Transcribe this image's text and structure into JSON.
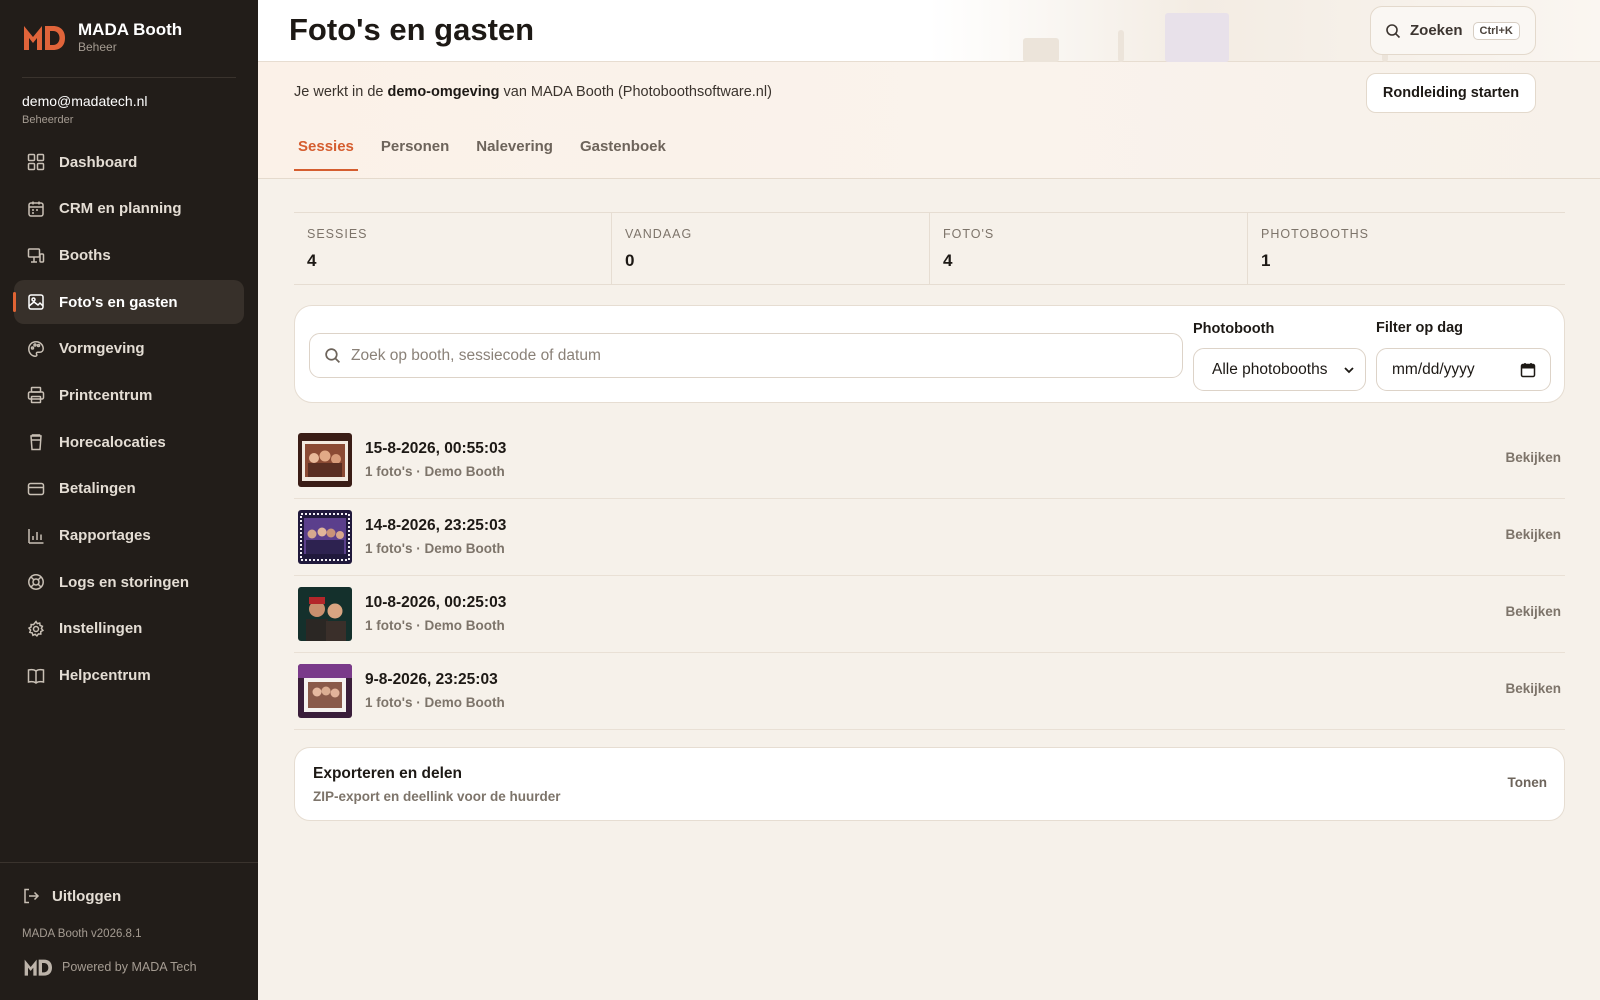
{
  "brand": {
    "name": "MADA Booth",
    "subtitle": "Beheer"
  },
  "user": {
    "email": "demo@madatech.nl",
    "role": "Beheerder"
  },
  "nav": [
    {
      "label": "Dashboard",
      "icon": "dashboard-icon",
      "active": false
    },
    {
      "label": "CRM en planning",
      "icon": "calendar-icon",
      "active": false
    },
    {
      "label": "Booths",
      "icon": "booth-icon",
      "active": false
    },
    {
      "label": "Foto's en gasten",
      "icon": "image-icon",
      "active": true
    },
    {
      "label": "Vormgeving",
      "icon": "palette-icon",
      "active": false
    },
    {
      "label": "Printcentrum",
      "icon": "printer-icon",
      "active": false
    },
    {
      "label": "Horecalocaties",
      "icon": "venue-icon",
      "active": false
    },
    {
      "label": "Betalingen",
      "icon": "credit-card-icon",
      "active": false
    },
    {
      "label": "Rapportages",
      "icon": "bar-chart-icon",
      "active": false
    },
    {
      "label": "Logs en storingen",
      "icon": "lifebuoy-icon",
      "active": false
    },
    {
      "label": "Instellingen",
      "icon": "gear-icon",
      "active": false
    },
    {
      "label": "Helpcentrum",
      "icon": "book-icon",
      "active": false
    }
  ],
  "footer": {
    "logout": "Uitloggen",
    "version": "MADA Booth v2026.8.1",
    "powered": "Powered by MADA Tech"
  },
  "header": {
    "title": "Foto's en gasten",
    "search_label": "Zoeken",
    "search_shortcut": "Ctrl+K"
  },
  "notice": {
    "prefix": "Je werkt in de",
    "bold": "demo-omgeving",
    "suffix": "van MADA Booth (Photoboothsoftware.nl)",
    "tour_button": "Rondleiding starten"
  },
  "tabs": [
    {
      "label": "Sessies",
      "active": true
    },
    {
      "label": "Personen",
      "active": false
    },
    {
      "label": "Nalevering",
      "active": false
    },
    {
      "label": "Gastenboek",
      "active": false
    }
  ],
  "stats": [
    {
      "label": "SESSIES",
      "value": "4"
    },
    {
      "label": "VANDAAG",
      "value": "0"
    },
    {
      "label": "FOTO'S",
      "value": "4"
    },
    {
      "label": "PHOTOBOOTHS",
      "value": "1"
    }
  ],
  "filters": {
    "search_placeholder": "Zoek op booth, sessiecode of datum",
    "photobooth_label": "Photobooth",
    "photobooth_value": "Alle photobooths",
    "date_label": "Filter op dag",
    "date_placeholder": "mm/dd/yyyy"
  },
  "sessions": [
    {
      "date": "15-8-2026, 00:55:03",
      "meta": "1 foto's · Demo Booth",
      "action": "Bekijken"
    },
    {
      "date": "14-8-2026, 23:25:03",
      "meta": "1 foto's · Demo Booth",
      "action": "Bekijken"
    },
    {
      "date": "10-8-2026, 00:25:03",
      "meta": "1 foto's · Demo Booth",
      "action": "Bekijken"
    },
    {
      "date": "9-8-2026, 23:25:03",
      "meta": "1 foto's · Demo Booth",
      "action": "Bekijken"
    }
  ],
  "export": {
    "title": "Exporteren en delen",
    "subtitle": "ZIP-export en deellink voor de huurder",
    "button": "Tonen"
  },
  "colors": {
    "accent": "#d55d2f",
    "sidebar_bg": "#221d19",
    "page_bg": "#f6f1ea"
  }
}
